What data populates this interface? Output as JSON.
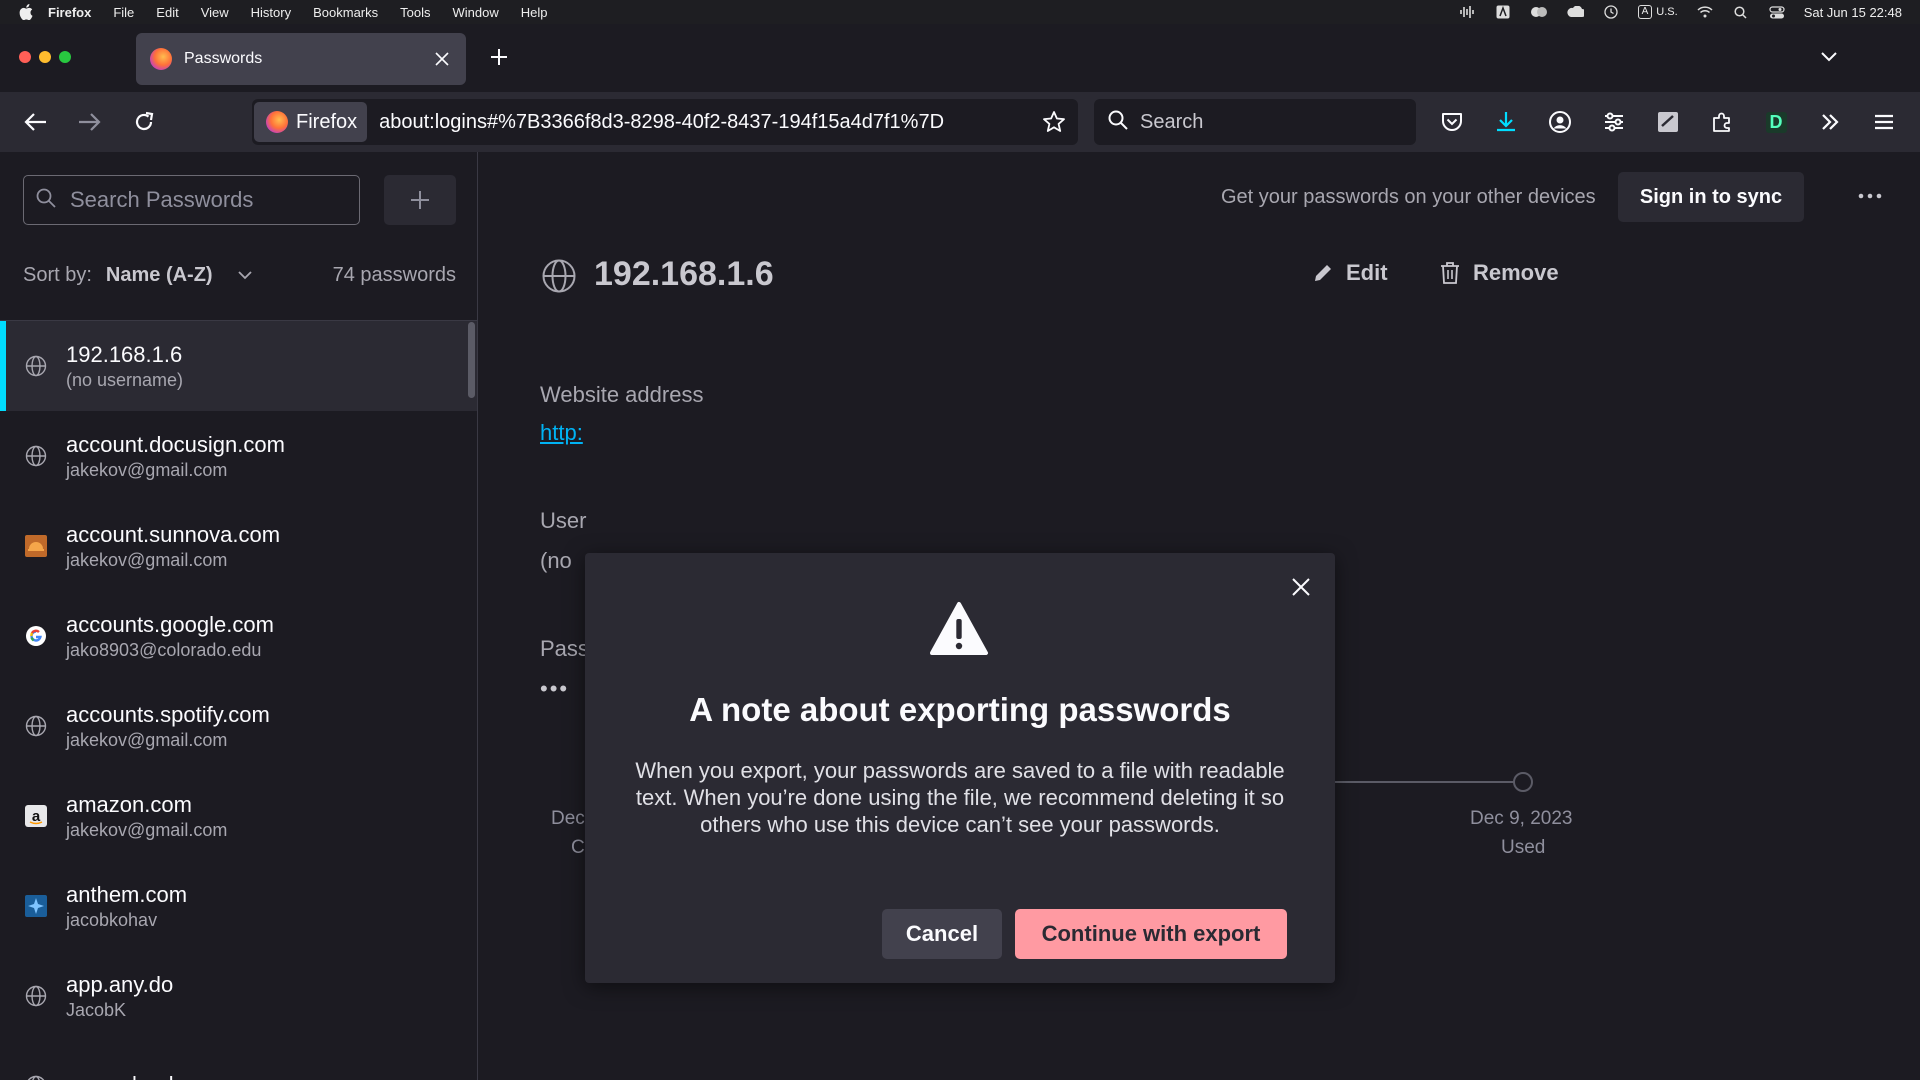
{
  "menubar": {
    "items": [
      "Firefox",
      "File",
      "Edit",
      "View",
      "History",
      "Bookmarks",
      "Tools",
      "Window",
      "Help"
    ],
    "input_source": "U.S.",
    "input_badge": "A",
    "datetime": "Sat Jun 15  22:48"
  },
  "tab": {
    "title": "Passwords"
  },
  "urlbar": {
    "identity": "Firefox",
    "url": "about:logins#%7B3366f8d3-8298-40f2-8437-194f15a4d7f1%7D"
  },
  "searchbar": {
    "placeholder": "Search"
  },
  "toolbar": {
    "profile_letter": "D"
  },
  "sidebar": {
    "search_placeholder": "Search Passwords",
    "sort_label": "Sort by:",
    "sort_value": "Name (A-Z)",
    "count": "74 passwords",
    "items": [
      {
        "site": "192.168.1.6",
        "user": "(no username)",
        "icon": "globe-icon"
      },
      {
        "site": "account.docusign.com",
        "user": "jakekov@gmail.com",
        "icon": "globe-icon"
      },
      {
        "site": "account.sunnova.com",
        "user": "jakekov@gmail.com",
        "icon": "sunnova-favicon"
      },
      {
        "site": "accounts.google.com",
        "user": "jako8903@colorado.edu",
        "icon": "google-favicon"
      },
      {
        "site": "accounts.spotify.com",
        "user": "jakekov@gmail.com",
        "icon": "globe-icon"
      },
      {
        "site": "amazon.com",
        "user": "jakekov@gmail.com",
        "icon": "amazon-favicon"
      },
      {
        "site": "anthem.com",
        "user": "jacobkohav",
        "icon": "anthem-favicon"
      },
      {
        "site": "app.any.do",
        "user": "JacobK",
        "icon": "globe-icon"
      },
      {
        "site": "app.calendar.com",
        "user": "",
        "icon": "globe-icon"
      }
    ]
  },
  "detail": {
    "sync_text": "Get your passwords on your other devices",
    "sync_button": "Sign in to sync",
    "title": "192.168.1.6",
    "edit": "Edit",
    "remove": "Remove",
    "website_label": "Website address",
    "website_value": "http:",
    "username_label": "User",
    "username_value": "(no",
    "password_label": "Pass",
    "password_value": "•••",
    "created_date": "Dec",
    "created_label": "Created",
    "used_date": "Dec 9, 2023",
    "used_label": "Used"
  },
  "modal": {
    "title": "A note about exporting passwords",
    "body": "When you export, your passwords are saved to a file with readable text. When you’re done using the file, we recommend deleting it so others who use this device can’t see your passwords.",
    "cancel": "Cancel",
    "continue": "Continue with export"
  },
  "colors": {
    "accent": "#00ddff",
    "primary_button": "#ff9aa2",
    "background": "#1c1b22",
    "surface": "#2b2a33"
  }
}
